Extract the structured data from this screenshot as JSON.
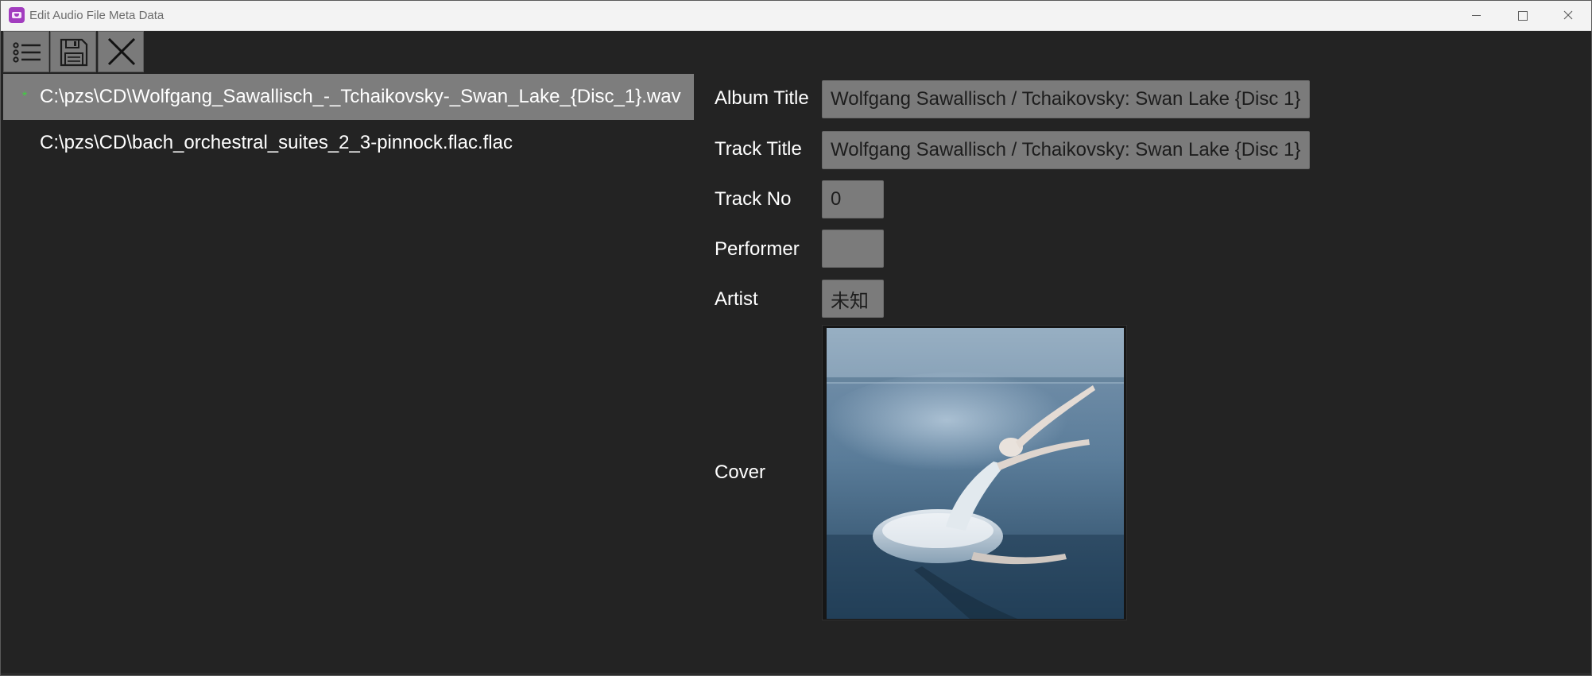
{
  "window": {
    "title": "Edit Audio File Meta Data",
    "icon": "audio-tag-app-icon",
    "controls": [
      "minimize-icon",
      "maximize-icon",
      "close-icon"
    ]
  },
  "toolbar": {
    "buttons": [
      {
        "name": "list-view-button",
        "icon": "list-icon"
      },
      {
        "name": "save-button",
        "icon": "floppy-disk-icon"
      },
      {
        "name": "close-button",
        "icon": "x-icon"
      }
    ]
  },
  "files": [
    {
      "marker": "*",
      "path": "C:\\pzs\\CD\\Wolfgang_Sawallisch_-_Tchaikovsky-_Swan_Lake_{Disc_1}.wav",
      "selected": true
    },
    {
      "marker": "",
      "path": "C:\\pzs\\CD\\bach_orchestral_suites_2_3-pinnock.flac.flac",
      "selected": false
    }
  ],
  "metadata": {
    "album_title": {
      "label": "Album Title",
      "value": "Wolfgang Sawallisch / Tchaikovsky: Swan Lake {Disc 1}"
    },
    "track_title": {
      "label": "Track Title",
      "value": "Wolfgang Sawallisch / Tchaikovsky: Swan Lake {Disc 1}"
    },
    "track_no": {
      "label": "Track No",
      "value": "0"
    },
    "performer": {
      "label": "Performer",
      "value": ""
    },
    "artist": {
      "label": "Artist",
      "value": "未知"
    },
    "cover": {
      "label": "Cover",
      "image": "ballerina-swan-cover-art"
    }
  },
  "colors": {
    "background": "#232323",
    "selected_row": "#7d7d7d",
    "input_bg": "#7b7b7b",
    "marker": "#3ed13e",
    "titlebar": "#f3f3f3"
  }
}
